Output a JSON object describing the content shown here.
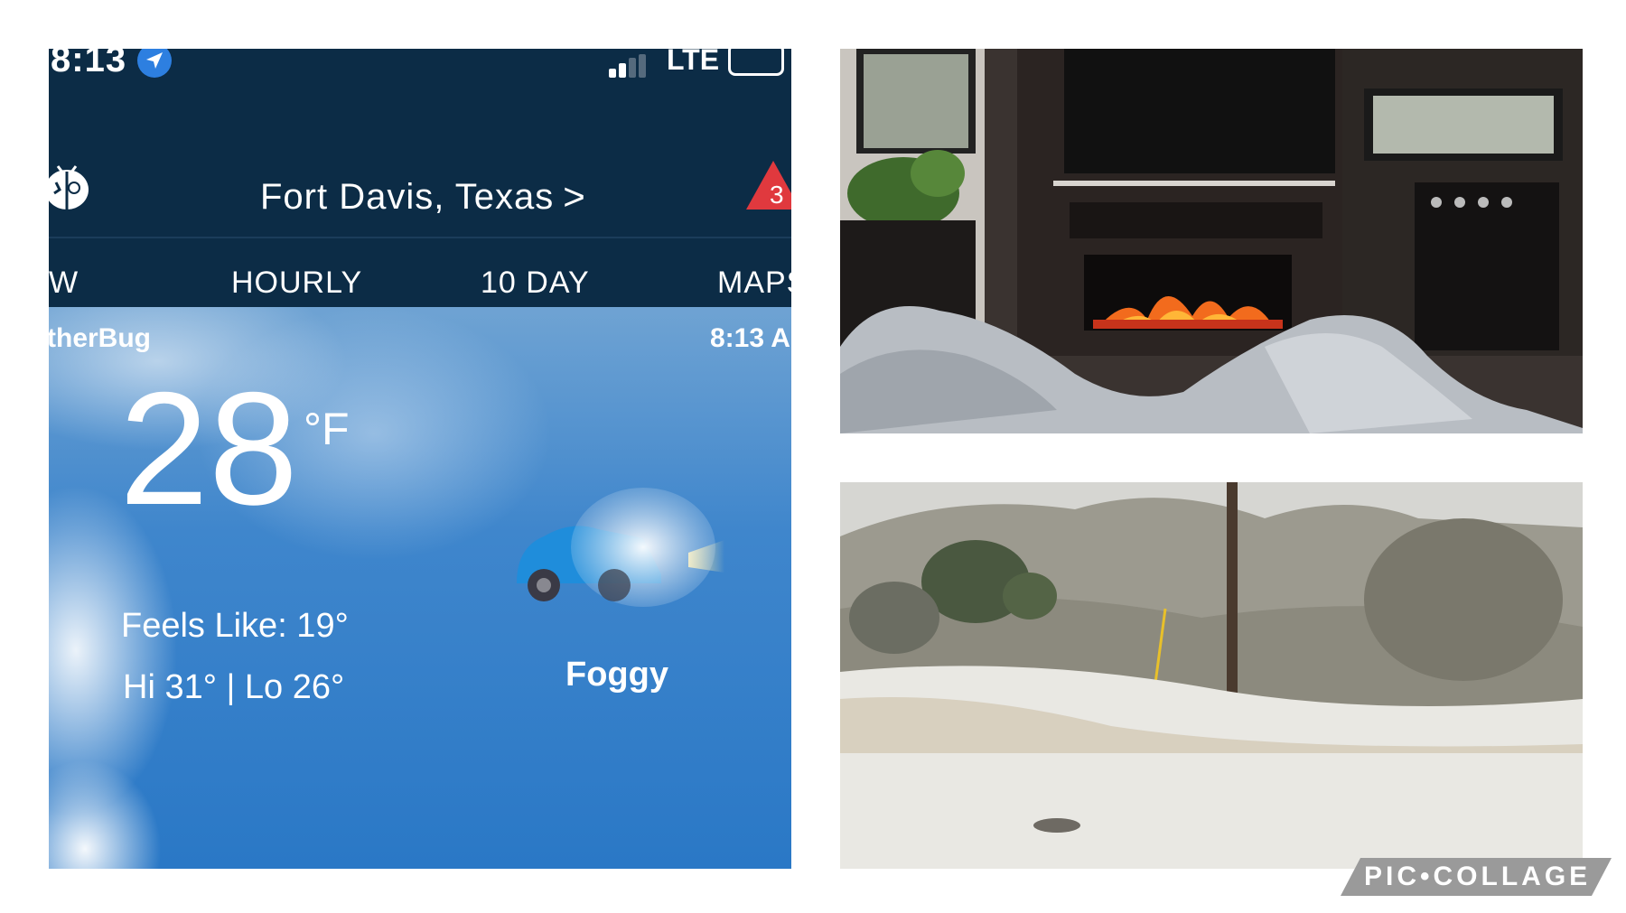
{
  "status_bar": {
    "time": "8:13",
    "network": "LTE"
  },
  "header": {
    "location": "Fort Davis, Texas",
    "location_chevron": ">",
    "alert_count": "3"
  },
  "tabs": [
    {
      "label": "W"
    },
    {
      "label": "HOURLY"
    },
    {
      "label": "10 DAY"
    },
    {
      "label": "MAPS"
    }
  ],
  "current": {
    "brand": "therBug",
    "observed_time": "8:13 A",
    "temperature": "28",
    "unit": "°F",
    "feels_like": "Feels Like: 19°",
    "hi_lo": "Hi 31° | Lo 26°",
    "condition": "Foggy",
    "condition_icon": "foggy-car-icon"
  },
  "watermark": {
    "text": "PIC•COLLAGE"
  },
  "colors": {
    "app_bar": "#0c2c46",
    "sky": "#2a78c6",
    "alert": "#e0393e"
  }
}
